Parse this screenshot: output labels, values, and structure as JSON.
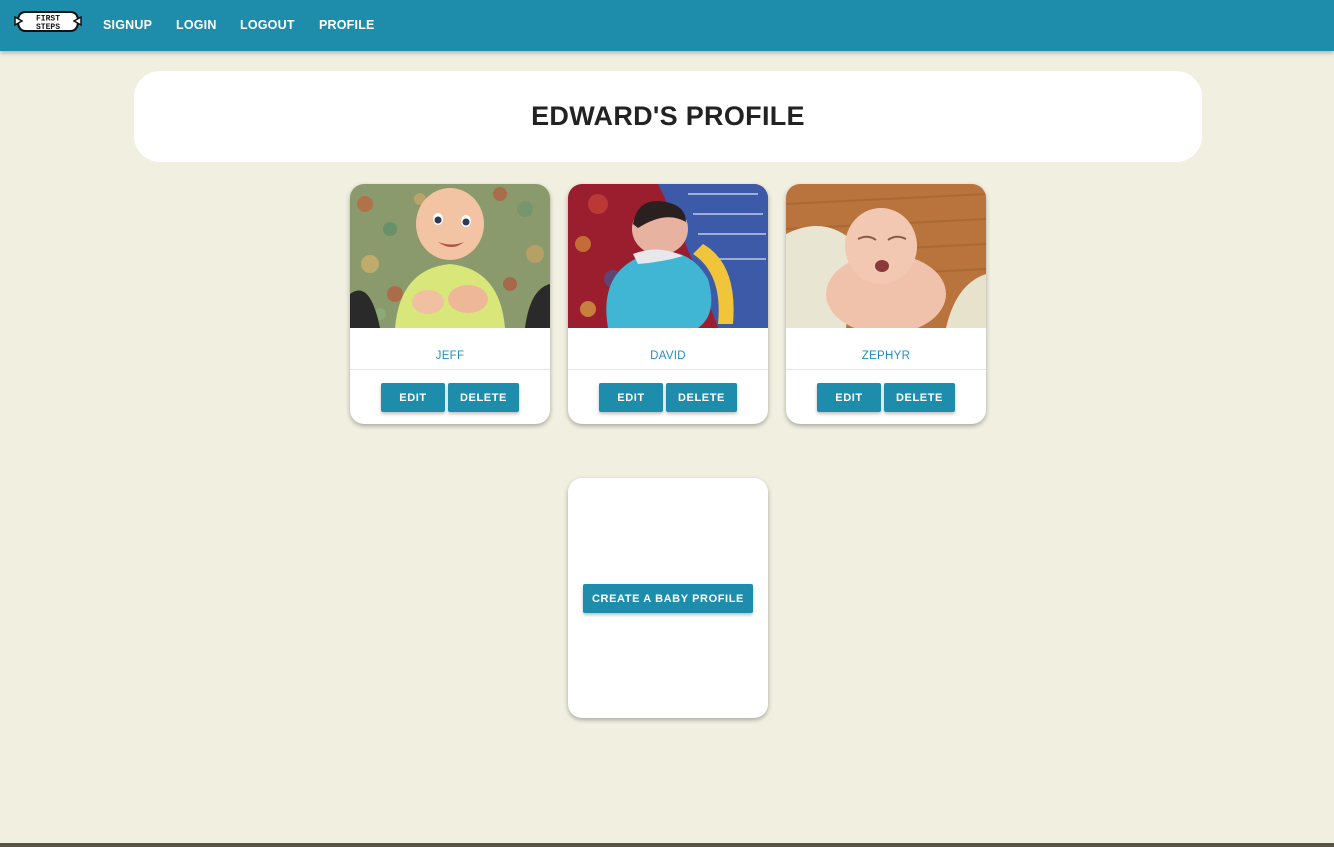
{
  "nav": {
    "logo_line1": "FIRST",
    "logo_line2": "STEPS",
    "links": [
      {
        "label": "SIGNUP"
      },
      {
        "label": "LOGIN"
      },
      {
        "label": "LOGOUT"
      },
      {
        "label": "PROFILE"
      }
    ]
  },
  "header": {
    "title": "EDWARD'S PROFILE"
  },
  "babies": [
    {
      "name": "JEFF",
      "edit_label": "EDIT",
      "delete_label": "DELETE"
    },
    {
      "name": "DAVID",
      "edit_label": "EDIT",
      "delete_label": "DELETE"
    },
    {
      "name": "ZEPHYR",
      "edit_label": "EDIT",
      "delete_label": "DELETE"
    }
  ],
  "create": {
    "label": "CREATE A BABY PROFILE"
  },
  "colors": {
    "brand": "#1e8cab",
    "background": "#f1efe0",
    "name_text": "#1f8fc0"
  }
}
